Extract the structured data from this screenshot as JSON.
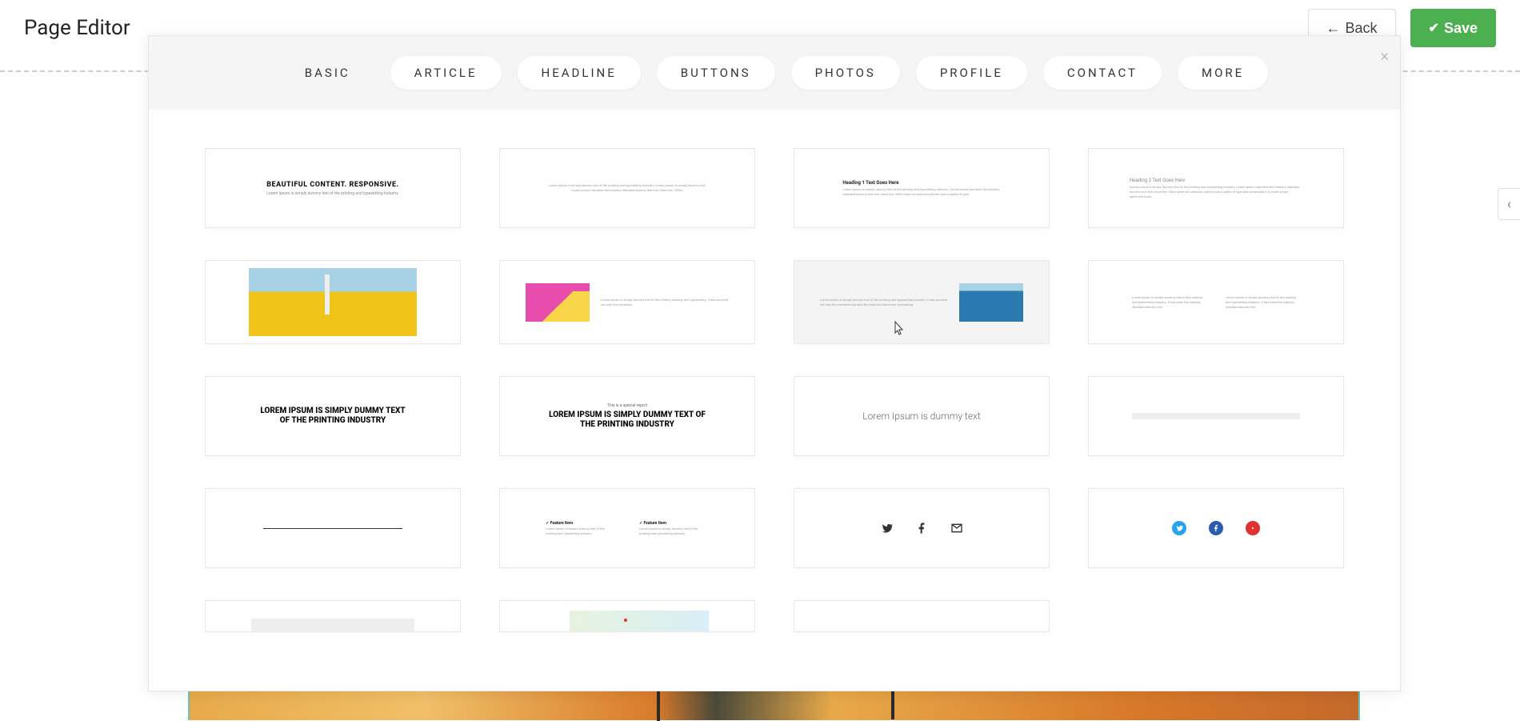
{
  "header": {
    "title": "Page Editor",
    "back": "Back",
    "save": "Save"
  },
  "modal": {
    "tabs": [
      "BASIC",
      "ARTICLE",
      "HEADLINE",
      "BUTTONS",
      "PHOTOS",
      "PROFILE",
      "CONTACT",
      "MORE"
    ],
    "active_tab_index": 0,
    "close_icon": "×"
  },
  "thumbs": {
    "r1c1_title": "BEAUTIFUL CONTENT. RESPONSIVE.",
    "r1c1_sub": "Lorem ipsum is simply dummy text of the printing and typesetting industry.",
    "r1c2_para": "Lorem ipsum is simply dummy text of the printing and typesetting industry. Lorem ipsum is simply dummy text. Lorem ipsum has been the industry standard dummy text ever since the 1500s.",
    "r1c3_head": "Heading 1 Text Goes Here",
    "r1c3_para": "Lorem ipsum is simply dummy text of the printing and typesetting industry. Lorem ipsum has been the industry standard dummy text ever since the 1500s when an unknown printer took a galley of type.",
    "r1c4_head": "Heading 2 Text Goes Here",
    "r1c4_para": "Lorem ipsum is simply dummy text of the printing and typesetting industry. Lorem ipsum has been the industry standard dummy text ever since the 1500s when an unknown printer took a galley of type and scrambled it to make a type specimen book.",
    "r2c2_para": "Lorem ipsum is simply dummy text of the printing industry and typesetting. It has survived not only five centuries.",
    "r2c3_para": "Lorem ipsum is simply dummy text of the printing and typesetting industry. It has survived not only five centuries but also the leap into electronic typesetting.",
    "r2c4_para1": "Lorem ipsum is simply dummy text of the printing and typesetting industry. It has been the industry standard dummy text.",
    "r2c4_para2": "Lorem ipsum is simply dummy text of the printing and typesetting industry. It has been the industry standard dummy text.",
    "r3c1_text": "LOREM IPSUM IS SIMPLY DUMMY TEXT OF THE PRINTING INDUSTRY",
    "r3c2_tag": "This is a special report",
    "r3c2_text": "LOREM IPSUM IS SIMPLY DUMMY TEXT OF THE PRINTING INDUSTRY",
    "r3c3_text": "Lorem Ipsum is dummy text",
    "r4c2_f1_title": "Feature Item",
    "r4c2_f1_text": "Lorem ipsum is simply dummy text of the printing and typesetting industry.",
    "r4c2_f2_title": "Feature Item",
    "r4c2_f2_text": "Lorem ipsum is simply dummy text of the printing and typesetting industry."
  },
  "icons": {
    "twitter": "twitter-icon",
    "facebook": "facebook-icon",
    "mail": "mail-icon",
    "youtube": "youtube-icon"
  }
}
